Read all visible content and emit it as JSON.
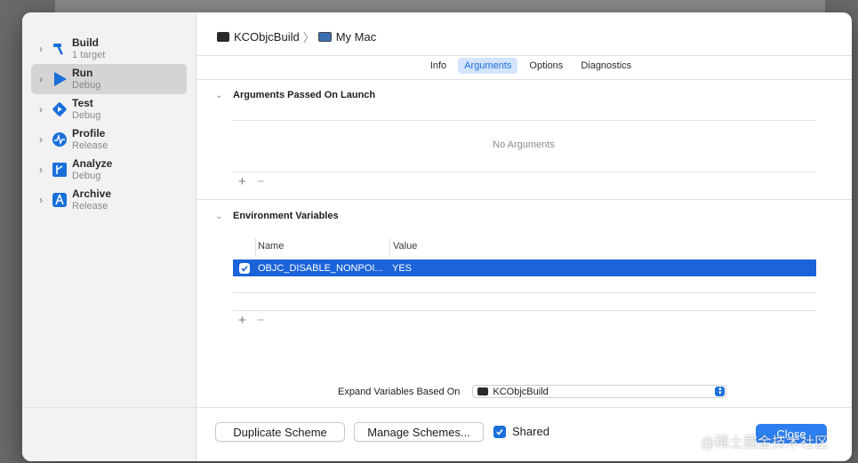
{
  "sidebar": {
    "items": [
      {
        "label": "Build",
        "sub": "1 target"
      },
      {
        "label": "Run",
        "sub": "Debug"
      },
      {
        "label": "Test",
        "sub": "Debug"
      },
      {
        "label": "Profile",
        "sub": "Release"
      },
      {
        "label": "Analyze",
        "sub": "Debug"
      },
      {
        "label": "Archive",
        "sub": "Release"
      }
    ],
    "selected_index": 1
  },
  "breadcrumb": {
    "scheme": "KCObjcBuild",
    "destination": "My Mac"
  },
  "tabs": [
    "Info",
    "Arguments",
    "Options",
    "Diagnostics"
  ],
  "active_tab": "Arguments",
  "arguments": {
    "title": "Arguments Passed On Launch",
    "empty_text": "No Arguments",
    "add_label": "+",
    "remove_label": "−"
  },
  "environment": {
    "title": "Environment Variables",
    "col_name": "Name",
    "col_value": "Value",
    "rows": [
      {
        "name": "OBJC_DISABLE_NONPOI...",
        "value": "YES",
        "enabled": true
      }
    ],
    "add_label": "+",
    "remove_label": "−"
  },
  "expand": {
    "label": "Expand Variables Based On",
    "value": "KCObjcBuild"
  },
  "footer": {
    "duplicate_label": "Duplicate Scheme",
    "manage_label": "Manage Schemes...",
    "shared_label": "Shared",
    "shared_checked": true,
    "close_label": "Close"
  },
  "watermark": "@稀土掘金技术社区",
  "colors": {
    "accent": "#1a6fd9",
    "selection": "#1a63d8",
    "sidebar_bg": "#f2f2f2"
  }
}
